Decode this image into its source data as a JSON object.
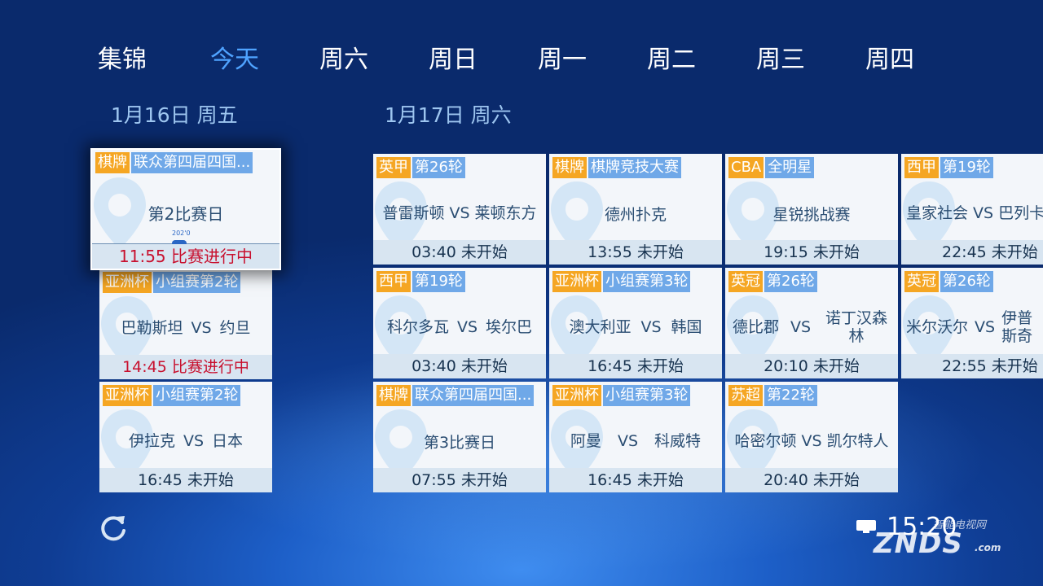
{
  "tabs": [
    {
      "label": "集锦",
      "active": false
    },
    {
      "label": "今天",
      "active": true
    },
    {
      "label": "周六",
      "active": false
    },
    {
      "label": "周日",
      "active": false
    },
    {
      "label": "周一",
      "active": false
    },
    {
      "label": "周二",
      "active": false
    },
    {
      "label": "周三",
      "active": false
    },
    {
      "label": "周四",
      "active": false
    }
  ],
  "dates": {
    "day1": "1月16日 周五",
    "day2": "1月17日 周六"
  },
  "cards": [
    {
      "cat": "棋牌",
      "round": "联众第四届四国...",
      "title": "第2比赛日",
      "status": "11:55 比赛进行中",
      "live": true,
      "progress_label": "202'0"
    },
    {
      "cat": "亚洲杯",
      "round": "小组赛第2轮",
      "home": "巴勒斯坦",
      "away": "约旦",
      "status": "14:45 比赛进行中",
      "live": true
    },
    {
      "cat": "亚洲杯",
      "round": "小组赛第2轮",
      "home": "伊拉克",
      "away": "日本",
      "status": "16:45 未开始"
    },
    {
      "cat": "英甲",
      "round": "第26轮",
      "home": "普雷斯顿",
      "away": "莱顿东方",
      "status": "03:40 未开始"
    },
    {
      "cat": "西甲",
      "round": "第19轮",
      "home": "科尔多瓦",
      "away": "埃尔巴",
      "status": "03:40 未开始"
    },
    {
      "cat": "棋牌",
      "round": "联众第四届四国...",
      "title": "第3比赛日",
      "status": "07:55 未开始"
    },
    {
      "cat": "棋牌",
      "round": "棋牌竞技大赛",
      "title": "德州扑克",
      "status": "13:55 未开始"
    },
    {
      "cat": "亚洲杯",
      "round": "小组赛第3轮",
      "home": "澳大利亚",
      "away": "韩国",
      "status": "16:45 未开始"
    },
    {
      "cat": "亚洲杯",
      "round": "小组赛第3轮",
      "home": "阿曼",
      "away": "科威特",
      "status": "16:45 未开始"
    },
    {
      "cat": "CBA",
      "round": "全明星",
      "title": "星锐挑战赛",
      "status": "19:15 未开始"
    },
    {
      "cat": "英冠",
      "round": "第26轮",
      "home": "德比郡",
      "away": "诺丁汉森林",
      "status": "20:10 未开始"
    },
    {
      "cat": "苏超",
      "round": "第22轮",
      "home": "哈密尔顿",
      "away": "凯尔特人",
      "status": "20:40 未开始"
    },
    {
      "cat": "西甲",
      "round": "第19轮",
      "home": "皇家社会",
      "away": "巴列卡",
      "status": "22:45 未开始"
    },
    {
      "cat": "英冠",
      "round": "第26轮",
      "home": "米尔沃尔",
      "away": "伊普斯奇",
      "status": "22:55 未开始"
    }
  ],
  "vs_label": "VS",
  "clock": "15:20",
  "watermark": {
    "brand": "ZNDS",
    "sub": "智能电视网",
    "domain": ".com"
  },
  "colors": {
    "accent": "#4fa3ff",
    "category_tag": "#f5a623",
    "round_tag": "#6fa8e8",
    "live_status": "#c8102e"
  }
}
